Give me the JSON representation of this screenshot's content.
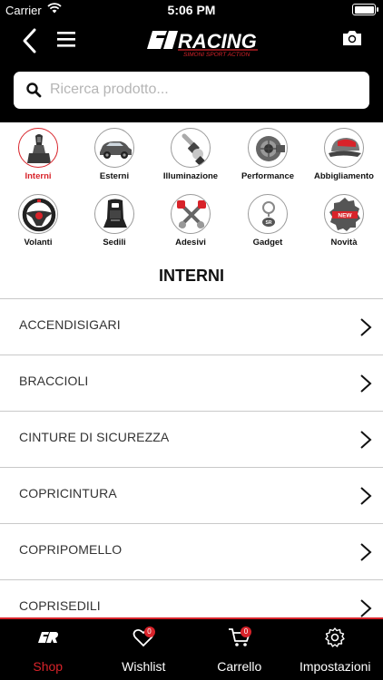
{
  "status_bar": {
    "carrier": "Carrier",
    "time": "5:06 PM"
  },
  "header": {
    "logo_text": "RACING",
    "logo_subtext": "SIMONI SPORT ACTION"
  },
  "search": {
    "placeholder": "Ricerca prodotto..."
  },
  "categories": [
    {
      "label": "Interni",
      "icon": "gear-knob-icon",
      "active": true
    },
    {
      "label": "Esterni",
      "icon": "car-icon",
      "active": false
    },
    {
      "label": "Illuminazione",
      "icon": "headlight-bulb-icon",
      "active": false
    },
    {
      "label": "Performance",
      "icon": "turbo-icon",
      "active": false
    },
    {
      "label": "Abbigliamento",
      "icon": "cap-icon",
      "active": false
    },
    {
      "label": "Volanti",
      "icon": "steering-wheel-icon",
      "active": false
    },
    {
      "label": "Sedili",
      "icon": "racing-seat-icon",
      "active": false
    },
    {
      "label": "Adesivi",
      "icon": "piston-sticker-icon",
      "active": false
    },
    {
      "label": "Gadget",
      "icon": "keyring-icon",
      "active": false
    },
    {
      "label": "Novità",
      "icon": "new-badge-icon",
      "active": false,
      "badge_text": "NEW"
    }
  ],
  "section": {
    "title": "INTERNI"
  },
  "list_items": [
    "ACCENDISIGARI",
    "BRACCIOLI",
    "CINTURE DI SICUREZZA",
    "COPRICINTURA",
    "COPRIPOMELLO",
    "COPRISEDILI"
  ],
  "tabs": [
    {
      "label": "Shop",
      "icon": "sr-logo-icon",
      "active": true
    },
    {
      "label": "Wishlist",
      "icon": "heart-icon",
      "badge": "0"
    },
    {
      "label": "Carrello",
      "icon": "cart-icon",
      "badge": "0"
    },
    {
      "label": "Impostazioni",
      "icon": "gear-icon"
    }
  ],
  "colors": {
    "accent": "#d8232a",
    "header_bg": "#000000",
    "divider": "#c9c9c9"
  }
}
